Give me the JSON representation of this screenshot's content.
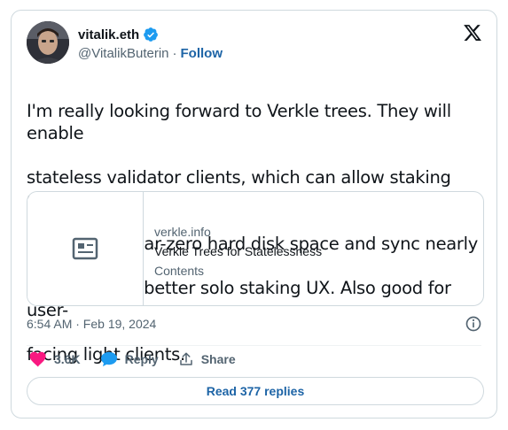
{
  "author": {
    "name": "vitalik.eth",
    "handle": "@VitalikButerin",
    "separator": "·",
    "follow_label": "Follow"
  },
  "tweet": {
    "text_lines": [
      "I'm really looking forward to Verkle trees. They will enable",
      "stateless validator clients, which can allow staking nodes",
      "to run with near-zero hard disk space and sync nearly",
      "instantly - far better solo staking UX. Also good for user-",
      "facing light clients."
    ]
  },
  "link_card": {
    "domain": "verkle.info",
    "title": "Verkle Trees for Statelessness",
    "description": "Contents",
    "thumb_icon": "article-icon"
  },
  "meta": {
    "timestamp": "6:54 AM · Feb 19, 2024",
    "info_icon": "info-icon"
  },
  "actions": {
    "like_count": "3.6K",
    "like_icon": "heart-icon",
    "reply_label": "Reply",
    "reply_icon": "speech-bubble-icon",
    "share_label": "Share",
    "share_icon": "share-icon"
  },
  "replies_button": {
    "label": "Read 377 replies"
  },
  "colors": {
    "accent": "#1d64a6",
    "verified": "#1d9bf0",
    "heart": "#f91880",
    "muted": "#536471",
    "border": "#cfd9de"
  }
}
